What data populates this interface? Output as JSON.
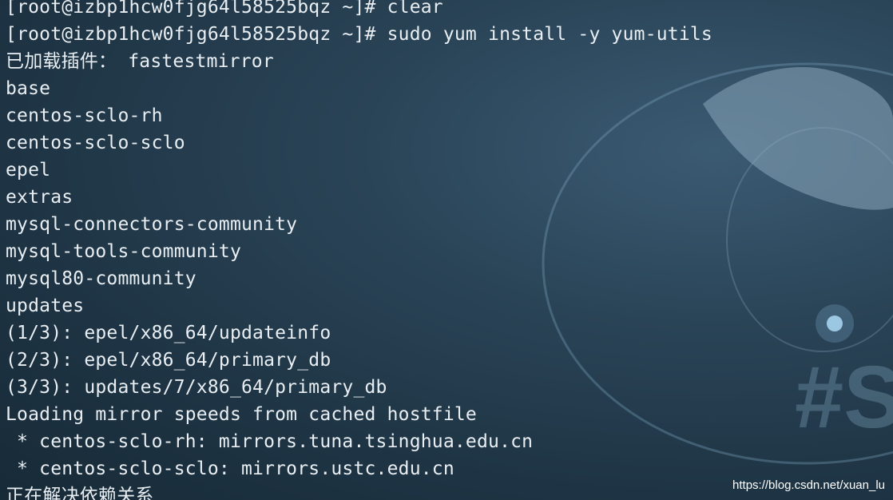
{
  "terminal": {
    "lines": [
      "[root@izbp1hcw0fjg64l58525bqz ~]# clear",
      "[root@izbp1hcw0fjg64l58525bqz ~]# sudo yum install -y yum-utils",
      "已加载插件： fastestmirror",
      "base",
      "centos-sclo-rh",
      "centos-sclo-sclo",
      "epel",
      "extras",
      "mysql-connectors-community",
      "mysql-tools-community",
      "mysql80-community",
      "updates",
      "(1/3): epel/x86_64/updateinfo",
      "(2/3): epel/x86_64/primary_db",
      "(3/3): updates/7/x86_64/primary_db",
      "Loading mirror speeds from cached hostfile",
      " * centos-sclo-rh: mirrors.tuna.tsinghua.edu.cn",
      " * centos-sclo-sclo: mirrors.ustc.edu.cn",
      "正在解决依赖关系"
    ]
  },
  "watermark": "https://blog.csdn.net/xuan_lu",
  "colors": {
    "text": "#e8eef2",
    "background": "#1e3444"
  }
}
